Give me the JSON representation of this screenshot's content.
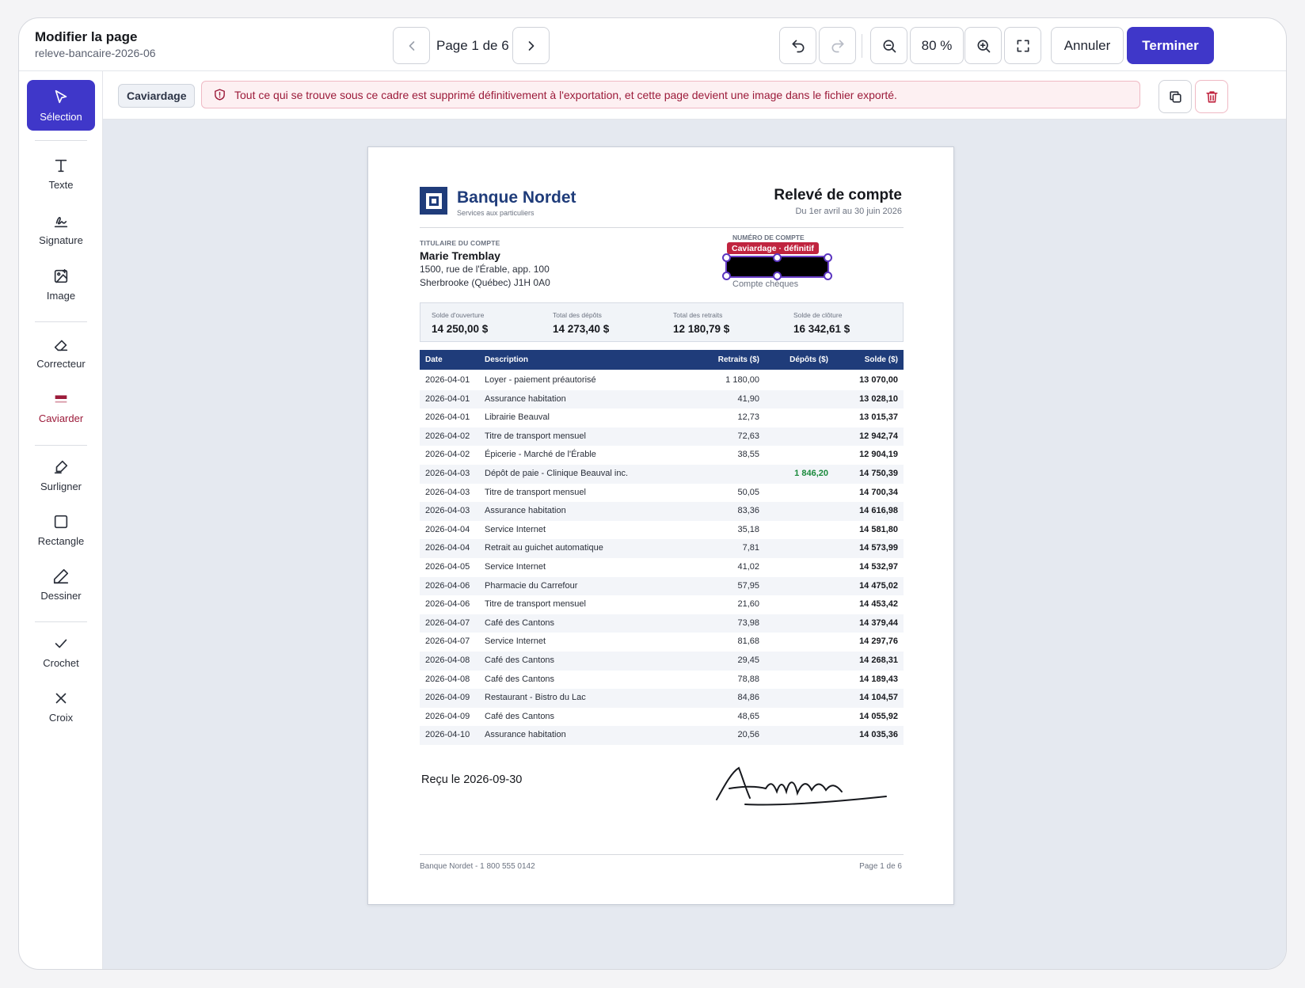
{
  "header": {
    "title": "Modifier la page",
    "subtitle": "releve-bancaire-2026-06",
    "page_indicator": "Page 1 de 6",
    "zoom": "80 %",
    "cancel_label": "Annuler",
    "done_label": "Terminer"
  },
  "tools": [
    {
      "label": "Sélection",
      "icon": "cursor-icon"
    },
    {
      "label": "Texte",
      "icon": "text-icon"
    },
    {
      "label": "Signature",
      "icon": "signature-icon"
    },
    {
      "label": "Image",
      "icon": "image-icon"
    },
    {
      "label": "Correcteur",
      "icon": "eraser-icon"
    },
    {
      "label": "Caviarder",
      "icon": "redact-icon"
    },
    {
      "label": "Surligner",
      "icon": "highlighter-icon"
    },
    {
      "label": "Rectangle",
      "icon": "rectangle-icon"
    },
    {
      "label": "Dessiner",
      "icon": "pen-icon"
    },
    {
      "label": "Crochet",
      "icon": "check-icon"
    },
    {
      "label": "Croix",
      "icon": "cross-icon"
    }
  ],
  "context": {
    "chip": "Caviardage",
    "warning": "Tout ce qui se trouve sous ce cadre est supprimé définitivement à l'exportation, et cette page devient une image dans le fichier exporté."
  },
  "colors": {
    "accent": "#3f37c9",
    "brand": "#1f3c7a",
    "redact": "#c0243f",
    "deposit": "#1a8a3c"
  },
  "document": {
    "bank_name": "Banque Nordet",
    "bank_tagline": "Services aux particuliers",
    "statement_title": "Relevé de compte",
    "period": "Du 1er avril au 30 juin 2026",
    "holder_label": "TITULAIRE DU COMPTE",
    "holder_name": "Marie Tremblay",
    "address_1": "1500, rue de l'Érable, app. 100",
    "address_2": "Sherbrooke (Québec)  J1H 0A0",
    "account_label": "NUMÉRO DE COMPTE",
    "redaction_tag": "Caviardage · définitif",
    "account_type": "Compte chèques",
    "summary": [
      {
        "label": "Solde d'ouverture",
        "value": "14 250,00 $"
      },
      {
        "label": "Total des dépôts",
        "value": "14 273,40 $"
      },
      {
        "label": "Total des retraits",
        "value": "12 180,79 $"
      },
      {
        "label": "Solde de clôture",
        "value": "16 342,61 $"
      }
    ],
    "columns": {
      "date": "Date",
      "description": "Description",
      "withdrawals": "Retraits ($)",
      "deposits": "Dépôts ($)",
      "balance": "Solde ($)"
    },
    "rows": [
      {
        "date": "2026-04-01",
        "desc": "Loyer - paiement préautorisé",
        "w": "1 180,00",
        "d": "",
        "b": "13 070,00"
      },
      {
        "date": "2026-04-01",
        "desc": "Assurance habitation",
        "w": "41,90",
        "d": "",
        "b": "13 028,10"
      },
      {
        "date": "2026-04-01",
        "desc": "Librairie Beauval",
        "w": "12,73",
        "d": "",
        "b": "13 015,37"
      },
      {
        "date": "2026-04-02",
        "desc": "Titre de transport mensuel",
        "w": "72,63",
        "d": "",
        "b": "12 942,74"
      },
      {
        "date": "2026-04-02",
        "desc": "Épicerie - Marché de l'Érable",
        "w": "38,55",
        "d": "",
        "b": "12 904,19"
      },
      {
        "date": "2026-04-03",
        "desc": "Dépôt de paie - Clinique Beauval inc.",
        "w": "",
        "d": "1 846,20",
        "b": "14 750,39"
      },
      {
        "date": "2026-04-03",
        "desc": "Titre de transport mensuel",
        "w": "50,05",
        "d": "",
        "b": "14 700,34"
      },
      {
        "date": "2026-04-03",
        "desc": "Assurance habitation",
        "w": "83,36",
        "d": "",
        "b": "14 616,98"
      },
      {
        "date": "2026-04-04",
        "desc": "Service Internet",
        "w": "35,18",
        "d": "",
        "b": "14 581,80"
      },
      {
        "date": "2026-04-04",
        "desc": "Retrait au guichet automatique",
        "w": "7,81",
        "d": "",
        "b": "14 573,99"
      },
      {
        "date": "2026-04-05",
        "desc": "Service Internet",
        "w": "41,02",
        "d": "",
        "b": "14 532,97"
      },
      {
        "date": "2026-04-06",
        "desc": "Pharmacie du Carrefour",
        "w": "57,95",
        "d": "",
        "b": "14 475,02"
      },
      {
        "date": "2026-04-06",
        "desc": "Titre de transport mensuel",
        "w": "21,60",
        "d": "",
        "b": "14 453,42"
      },
      {
        "date": "2026-04-07",
        "desc": "Café des Cantons",
        "w": "73,98",
        "d": "",
        "b": "14 379,44"
      },
      {
        "date": "2026-04-07",
        "desc": "Service Internet",
        "w": "81,68",
        "d": "",
        "b": "14 297,76"
      },
      {
        "date": "2026-04-08",
        "desc": "Café des Cantons",
        "w": "29,45",
        "d": "",
        "b": "14 268,31"
      },
      {
        "date": "2026-04-08",
        "desc": "Café des Cantons",
        "w": "78,88",
        "d": "",
        "b": "14 189,43"
      },
      {
        "date": "2026-04-09",
        "desc": "Restaurant - Bistro du Lac",
        "w": "84,86",
        "d": "",
        "b": "14 104,57"
      },
      {
        "date": "2026-04-09",
        "desc": "Café des Cantons",
        "w": "48,65",
        "d": "",
        "b": "14 055,92"
      },
      {
        "date": "2026-04-10",
        "desc": "Assurance habitation",
        "w": "20,56",
        "d": "",
        "b": "14 035,36"
      }
    ],
    "received_note": "Reçu le 2026-09-30",
    "footer_left": "Banque Nordet - 1 800 555 0142",
    "footer_right": "Page 1 de 6"
  }
}
